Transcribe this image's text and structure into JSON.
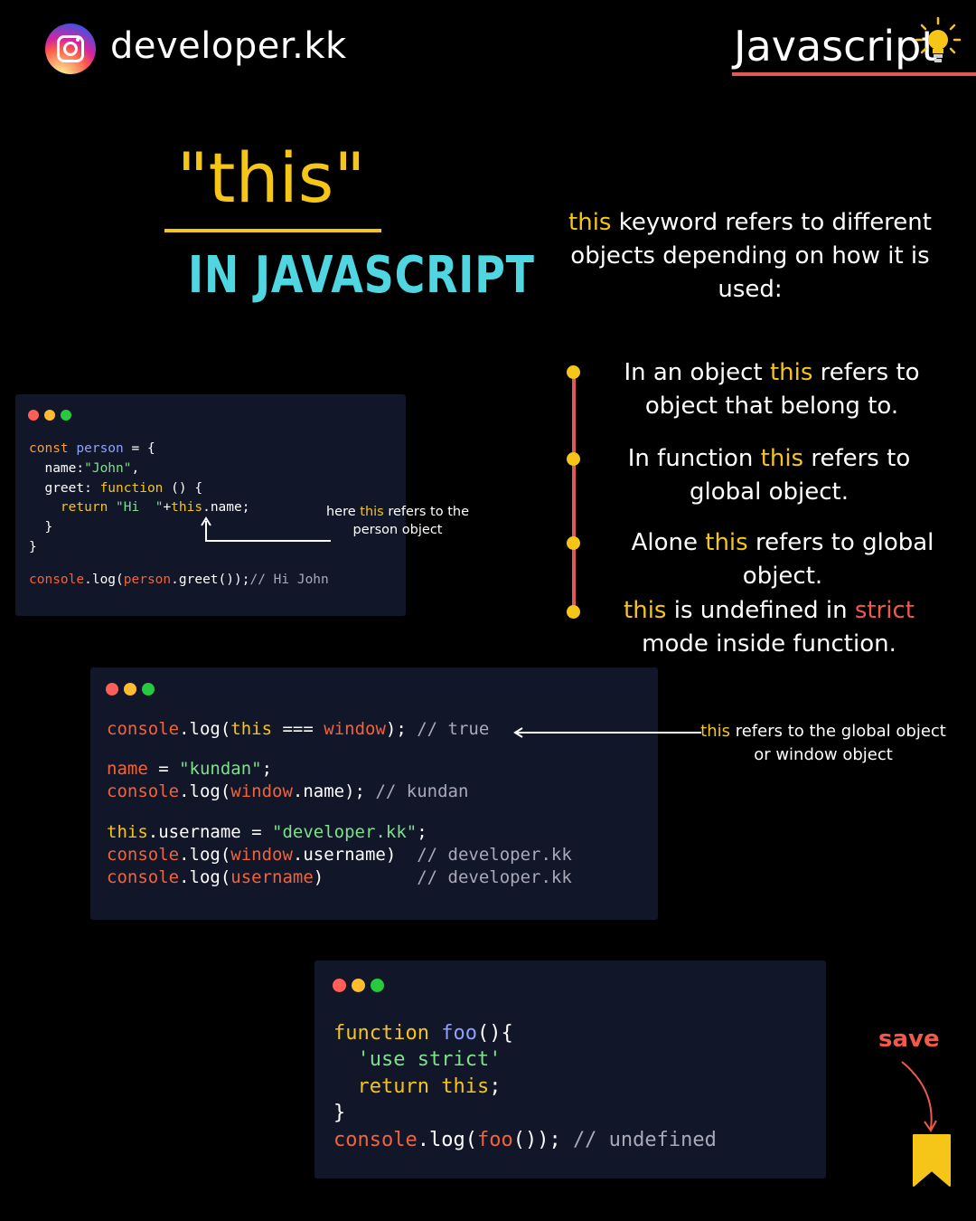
{
  "header": {
    "handle": "developer.kk",
    "tag": "Javascript",
    "icons": [
      "instagram-icon",
      "light-bulb-icon"
    ]
  },
  "title": {
    "main": "\"this\"",
    "sub": "IN JAVASCRIPT"
  },
  "intro": {
    "keyword": "this",
    "text": " keyword refers to different objects depending on how it is used:"
  },
  "bullets": [
    {
      "pre": "In an object ",
      "kw": "this",
      "post": " refers to object that belong to."
    },
    {
      "pre": "In function ",
      "kw": "this",
      "post": " refers to global object."
    },
    {
      "pre": "Alone ",
      "kw": "this",
      "post": " refers to global object."
    },
    {
      "pre": "",
      "kw": "this",
      "mid": " is undefined in ",
      "kw2": "strict",
      "post": " mode inside function."
    }
  ],
  "snippet1": {
    "lines": [
      [
        [
          "const ",
          "c-org"
        ],
        [
          "person",
          "c-var"
        ],
        [
          " = {",
          ""
        ]
      ],
      [
        [
          "  name:",
          ""
        ],
        [
          "\"John\"",
          "c-str"
        ],
        [
          ",",
          ""
        ]
      ],
      [
        [
          "  greet: ",
          ""
        ],
        [
          "function",
          "c-kw"
        ],
        [
          " () {",
          ""
        ]
      ],
      [
        [
          "    ",
          ""
        ],
        [
          "return",
          "c-kw"
        ],
        [
          " ",
          ""
        ],
        [
          "\"Hi  \"",
          "c-str"
        ],
        [
          "+",
          ""
        ],
        [
          "this",
          "c-kw"
        ],
        [
          ".name;",
          ""
        ]
      ],
      [
        [
          "  }",
          ""
        ]
      ],
      [
        [
          "}",
          ""
        ]
      ],
      [
        [
          "",
          ""
        ]
      ],
      [
        [
          "console",
          "c-red"
        ],
        [
          ".log(",
          ""
        ],
        [
          "person",
          "c-red"
        ],
        [
          ".greet());",
          ""
        ],
        [
          "// Hi John",
          "c-cm"
        ]
      ]
    ],
    "note_pre": "here ",
    "note_kw": "this",
    "note_post": " refers to the person object"
  },
  "snippet2": {
    "lines": [
      [
        [
          "console",
          "c-red"
        ],
        [
          ".log(",
          ""
        ],
        [
          "this",
          "c-kw"
        ],
        [
          " === ",
          ""
        ],
        [
          "window",
          "c-red"
        ],
        [
          "); ",
          ""
        ],
        [
          "// true",
          "c-cm"
        ]
      ],
      [
        [
          "",
          ""
        ]
      ],
      [
        [
          "name",
          "c-red"
        ],
        [
          " = ",
          ""
        ],
        [
          "\"kundan\"",
          "c-str"
        ],
        [
          ";",
          ""
        ]
      ],
      [
        [
          "console",
          "c-red"
        ],
        [
          ".log(",
          ""
        ],
        [
          "window",
          "c-red"
        ],
        [
          ".name); ",
          ""
        ],
        [
          "// kundan",
          "c-cm"
        ]
      ],
      [
        [
          "",
          ""
        ]
      ],
      [
        [
          "this",
          "c-kw"
        ],
        [
          ".username = ",
          ""
        ],
        [
          "\"developer.kk\"",
          "c-str"
        ],
        [
          ";",
          ""
        ]
      ],
      [
        [
          "console",
          "c-red"
        ],
        [
          ".log(",
          ""
        ],
        [
          "window",
          "c-red"
        ],
        [
          ".username)  ",
          ""
        ],
        [
          "// developer.kk",
          "c-cm"
        ]
      ],
      [
        [
          "console",
          "c-red"
        ],
        [
          ".log(",
          ""
        ],
        [
          "username",
          "c-red"
        ],
        [
          ")         ",
          ""
        ],
        [
          "// developer.kk",
          "c-cm"
        ]
      ]
    ],
    "note_kw": "this",
    "note_post": " refers to the global object or window object"
  },
  "snippet3": {
    "lines": [
      [
        [
          "function",
          "c-kw"
        ],
        [
          " ",
          ""
        ],
        [
          "foo",
          "c-var"
        ],
        [
          "(){",
          ""
        ]
      ],
      [
        [
          "  ",
          ""
        ],
        [
          "'use strict'",
          "c-str"
        ]
      ],
      [
        [
          "  ",
          ""
        ],
        [
          "return",
          "c-kw"
        ],
        [
          " ",
          ""
        ],
        [
          "this",
          "c-kw"
        ],
        [
          ";",
          ""
        ]
      ],
      [
        [
          "}",
          ""
        ]
      ],
      [
        [
          "console",
          "c-red"
        ],
        [
          ".log(",
          ""
        ],
        [
          "foo",
          "c-red"
        ],
        [
          "()); ",
          ""
        ],
        [
          "// undefined",
          "c-cm"
        ]
      ]
    ]
  },
  "save": {
    "label": "save",
    "icon": "bookmark-icon"
  },
  "colors": {
    "accent": "#f5c518",
    "title_sub": "#4fd6e0",
    "red": "#e05a55",
    "code_bg": "#121629"
  }
}
